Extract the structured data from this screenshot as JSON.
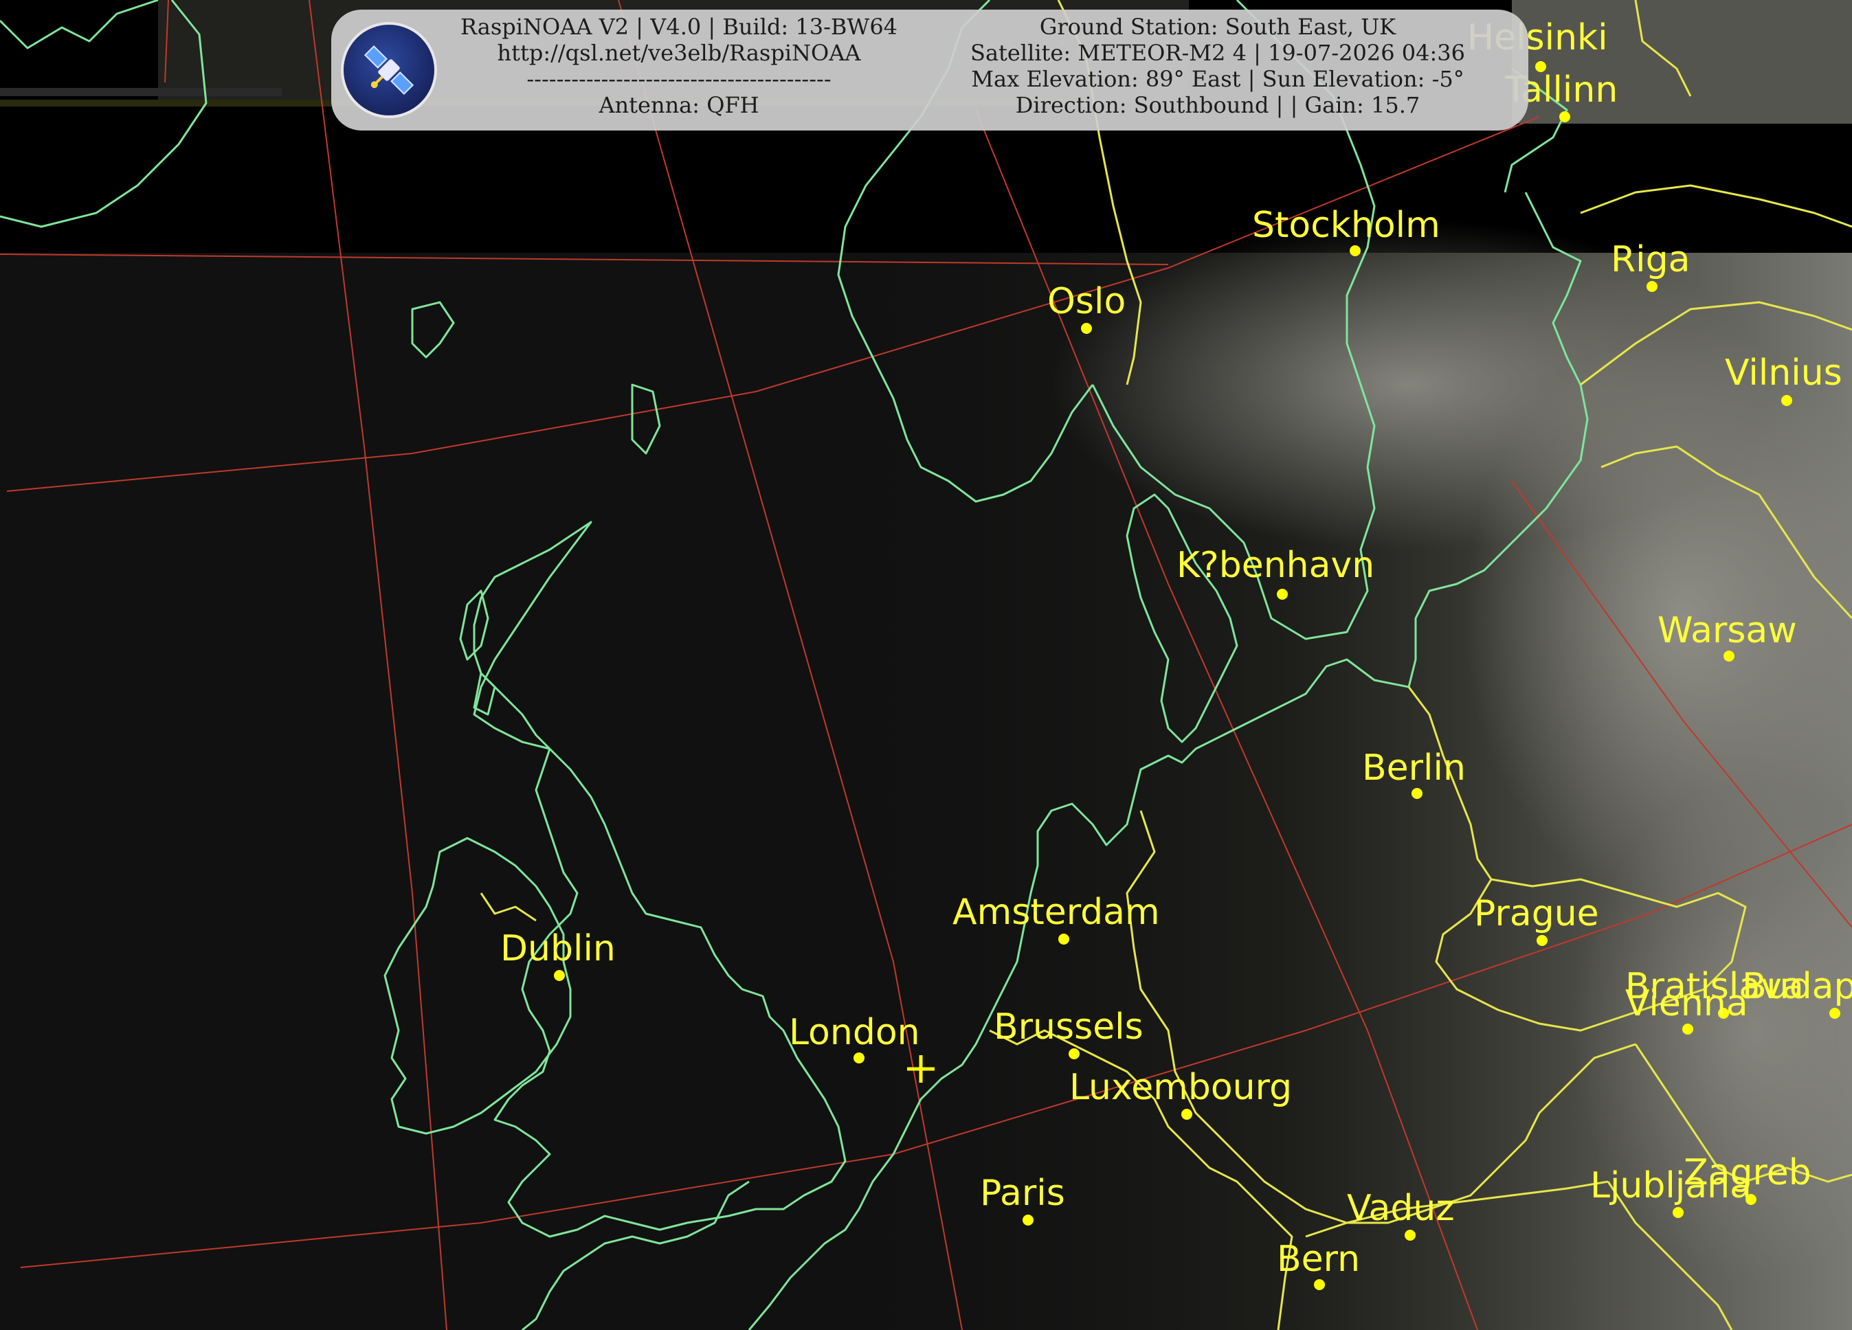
{
  "header": {
    "left_lines": [
      "RaspiNOAA V2 | V4.0 | Build: 13-BW64",
      "http://qsl.net/ve3elb/RaspiNOAA",
      "-----------------------------------------",
      "Antenna: QFH"
    ],
    "right_lines": [
      "Ground Station: South East, UK",
      "Satellite: METEOR-M2 4 | 19-07-2026 04:36",
      "Max Elevation: 89° East | Sun Elevation: -5°",
      "Direction: Southbound | | Gain: 15.7"
    ],
    "logo_icon": "satellite-icon"
  },
  "map": {
    "colors": {
      "coastline": "#7fe59a",
      "border": "#e6e64a",
      "graticule": "#c0392b",
      "city_label": "#ffff3a",
      "city_marker": "#ffff00",
      "ground_station_marker": "#ffff00"
    },
    "ground_station_icon": "plus-icon",
    "cities": [
      {
        "name": "Helsinki"
      },
      {
        "name": "Tallinn"
      },
      {
        "name": "Stockholm"
      },
      {
        "name": "Riga"
      },
      {
        "name": "Oslo"
      },
      {
        "name": "Vilnius"
      },
      {
        "name": "K?benhavn"
      },
      {
        "name": "Warsaw"
      },
      {
        "name": "Berlin"
      },
      {
        "name": "Amsterdam"
      },
      {
        "name": "Prague"
      },
      {
        "name": "Dublin"
      },
      {
        "name": "Bratislava"
      },
      {
        "name": "Vienna"
      },
      {
        "name": "Budapest"
      },
      {
        "name": "London"
      },
      {
        "name": "Brussels"
      },
      {
        "name": "Luxembourg"
      },
      {
        "name": "Paris"
      },
      {
        "name": "Vaduz"
      },
      {
        "name": "Ljubljana"
      },
      {
        "name": "Zagreb"
      },
      {
        "name": "Bern"
      }
    ]
  }
}
